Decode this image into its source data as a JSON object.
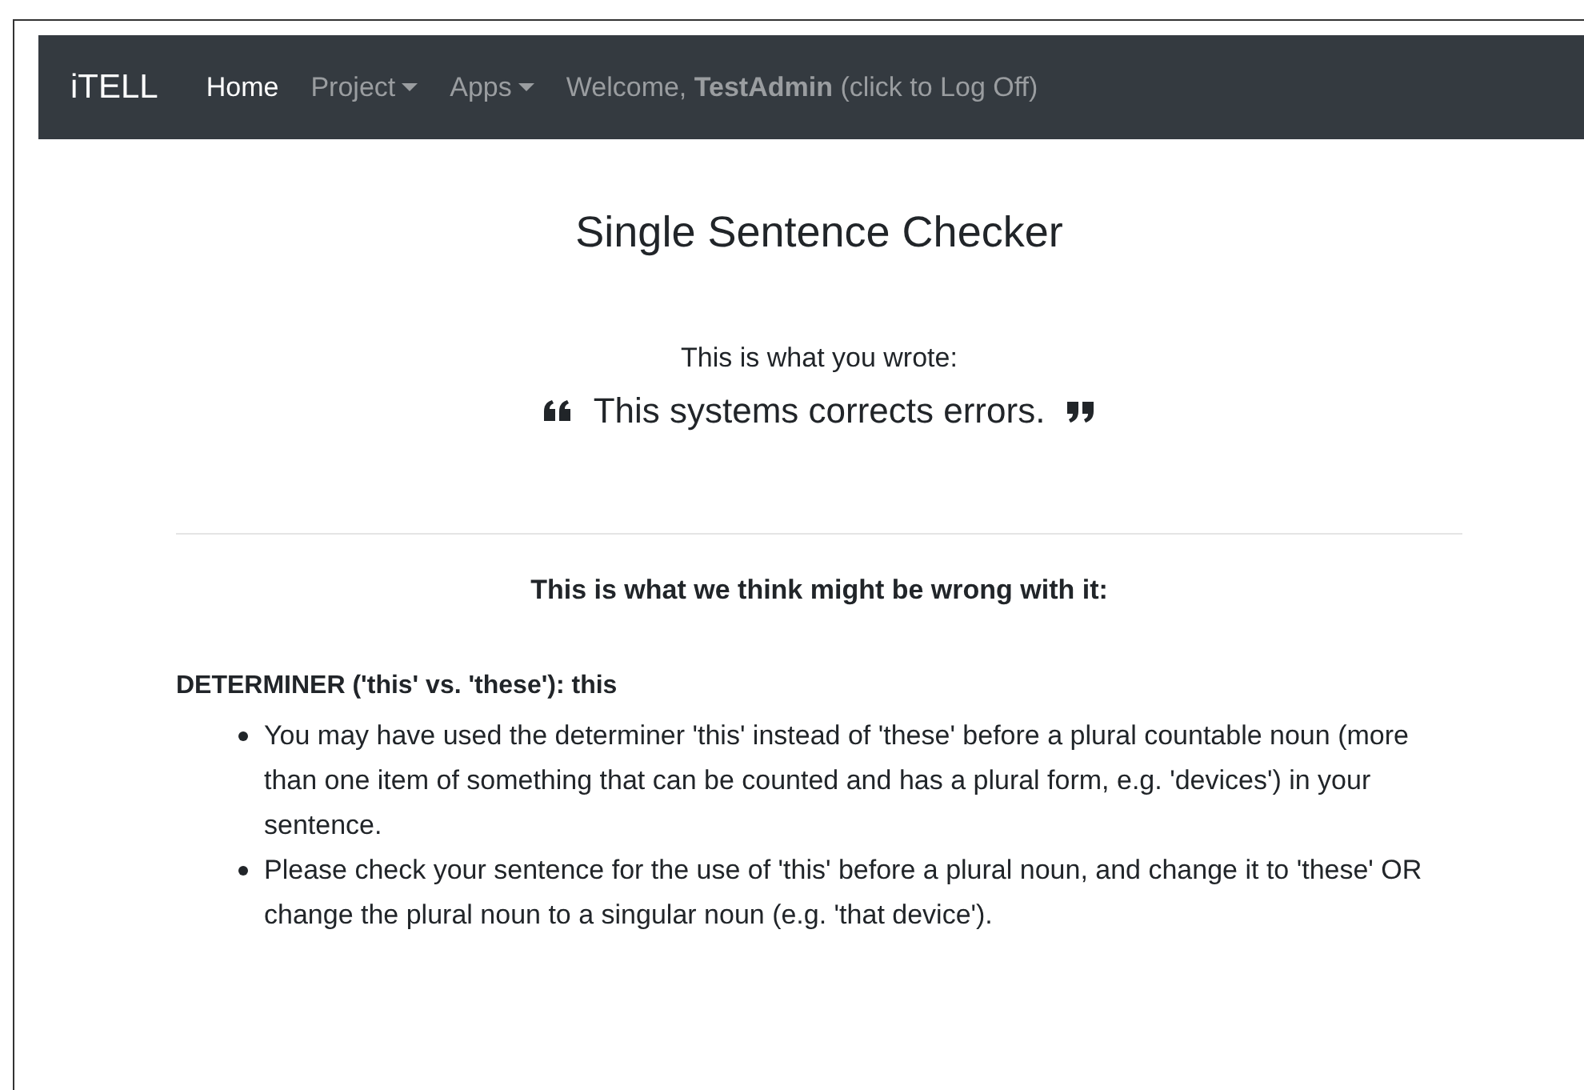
{
  "navbar": {
    "brand": "iTELL",
    "items": [
      {
        "label": "Home",
        "selected": true,
        "kind": "link"
      },
      {
        "label": "Project",
        "selected": false,
        "kind": "dropdown"
      },
      {
        "label": "Apps",
        "selected": false,
        "kind": "dropdown"
      },
      {
        "label": "Welcome, **TestAdmin** (click to Log Off)",
        "selected": false,
        "kind": "link"
      }
    ]
  },
  "heading": "Single Sentence Checker",
  "written_label": "This is what you wrote:",
  "sentence": "This systems corrects errors.",
  "feedback_heading": "This is what we think might be wrong with it:",
  "issues": [
    {
      "title": "DETERMINER ('this' vs. 'these'): this",
      "points": [
        "You may have used the determiner 'this' instead of 'these' before a plural countable noun (more than one item of something that can be counted and has a plural form, e.g. 'devices') in your sentence.",
        "Please check your sentence for the use of 'this' before a plural noun, and change it to 'these' OR change the plural noun to a singular noun (e.g. 'that device')."
      ]
    }
  ]
}
